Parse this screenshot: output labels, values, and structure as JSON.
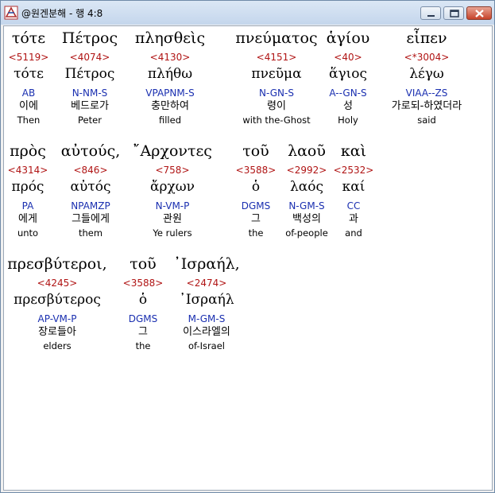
{
  "window": {
    "title": "@원겐분해 - 행 4:8"
  },
  "rows": [
    {
      "words": [
        {
          "greek": "τότε",
          "strong": "<5119>",
          "lemma": "τότε",
          "parse": "AB",
          "korean": "이에",
          "english": "Then"
        },
        {
          "greek": "Πέτρος",
          "strong": "<4074>",
          "lemma": "Πέτρος",
          "parse": "N-NM-S",
          "korean": "베드로가",
          "english": "Peter"
        },
        {
          "greek": "πλησθεὶς",
          "strong": "<4130>",
          "lemma": "πλήθω",
          "parse": "VPAPNM-S",
          "korean": "충만하여",
          "english": "filled"
        },
        {
          "greek": "πνεύματος",
          "strong": "<4151>",
          "lemma": "πνεῦμα",
          "parse": "N-GN-S",
          "korean": "령이",
          "english": "with the-Ghost"
        },
        {
          "greek": "ἁγίου",
          "strong": "<40>",
          "lemma": "ἅγιος",
          "parse": "A--GN-S",
          "korean": "성",
          "english": "Holy"
        },
        {
          "greek": "εἶπεν",
          "strong": "<*3004>",
          "lemma": "λέγω",
          "parse": "VIAA--ZS",
          "korean": "가로되-하였더라",
          "english": "said"
        }
      ]
    },
    {
      "words": [
        {
          "greek": "πρὸς",
          "strong": "<4314>",
          "lemma": "πρός",
          "parse": "PA",
          "korean": "에게",
          "english": "unto"
        },
        {
          "greek": "αὐτούς,",
          "strong": "<846>",
          "lemma": "αὐτός",
          "parse": "NPAMZP",
          "korean": "그들에게",
          "english": "them"
        },
        {
          "greek": "῎Αρχοντες",
          "strong": "<758>",
          "lemma": "ἄρχων",
          "parse": "N-VM-P",
          "korean": "관원",
          "english": "Ye rulers"
        },
        {
          "greek": "τοῦ",
          "strong": "<3588>",
          "lemma": "ὁ",
          "parse": "DGMS",
          "korean": "그",
          "english": "the"
        },
        {
          "greek": "λαοῦ",
          "strong": "<2992>",
          "lemma": "λαός",
          "parse": "N-GM-S",
          "korean": "백성의",
          "english": "of-people"
        },
        {
          "greek": "καὶ",
          "strong": "<2532>",
          "lemma": "καί",
          "parse": "CC",
          "korean": "과",
          "english": "and"
        }
      ]
    },
    {
      "words": [
        {
          "greek": "πρεσβύτεροι,",
          "strong": "<4245>",
          "lemma": "πρεσβύτερος",
          "parse": "AP-VM-P",
          "korean": "장로들아",
          "english": "elders"
        },
        {
          "greek": "τοῦ",
          "strong": "<3588>",
          "lemma": "ὁ",
          "parse": "DGMS",
          "korean": "그",
          "english": "the"
        },
        {
          "greek": "᾿Ισραήλ,",
          "strong": "<2474>",
          "lemma": "᾿Ισραήλ",
          "parse": "M-GM-S",
          "korean": "이스라엘의",
          "english": "of-Israel"
        }
      ]
    }
  ],
  "colors": {
    "strong": "#b01414",
    "parse": "#1a2fb0",
    "highlight": "#ffffff"
  },
  "icons": {
    "app": "bible-app-icon",
    "minimize": "minimize-icon",
    "maximize": "maximize-icon",
    "close": "close-icon"
  }
}
